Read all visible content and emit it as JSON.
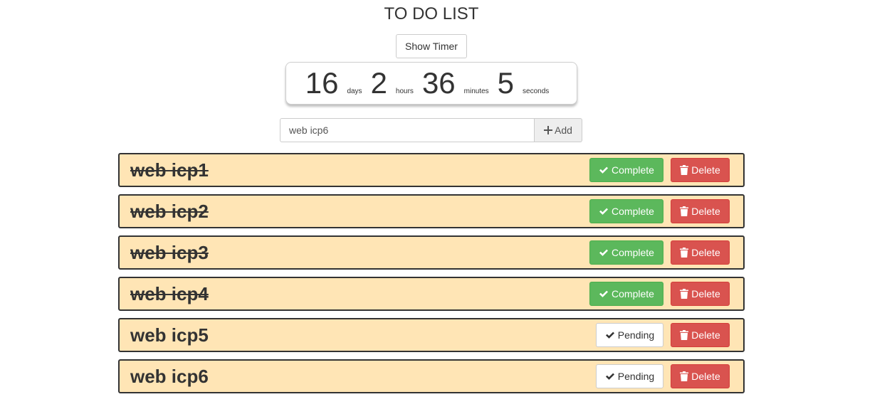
{
  "header": {
    "title": "TO DO LIST",
    "show_timer_label": "Show Timer"
  },
  "countdown": {
    "days": "16",
    "days_unit": "days",
    "hours": "2",
    "hours_unit": "hours",
    "minutes": "36",
    "minutes_unit": "minutes",
    "seconds": "5",
    "seconds_unit": "seconds"
  },
  "new_task": {
    "value": "web icp6",
    "add_label": "Add",
    "add_icon": "plus-icon"
  },
  "colors": {
    "row_background": "#ffe5b5",
    "complete_green": "#5cb85c",
    "delete_red": "#d9534f"
  },
  "tasks": [
    {
      "text": "web icp1",
      "done": true,
      "status_label": "Complete",
      "delete_label": "Delete"
    },
    {
      "text": "web icp2",
      "done": true,
      "status_label": "Complete",
      "delete_label": "Delete"
    },
    {
      "text": "web icp3",
      "done": true,
      "status_label": "Complete",
      "delete_label": "Delete"
    },
    {
      "text": "web icp4",
      "done": true,
      "status_label": "Complete",
      "delete_label": "Delete"
    },
    {
      "text": "web icp5",
      "done": false,
      "status_label": "Pending",
      "delete_label": "Delete"
    },
    {
      "text": "web icp6",
      "done": false,
      "status_label": "Pending",
      "delete_label": "Delete"
    }
  ]
}
